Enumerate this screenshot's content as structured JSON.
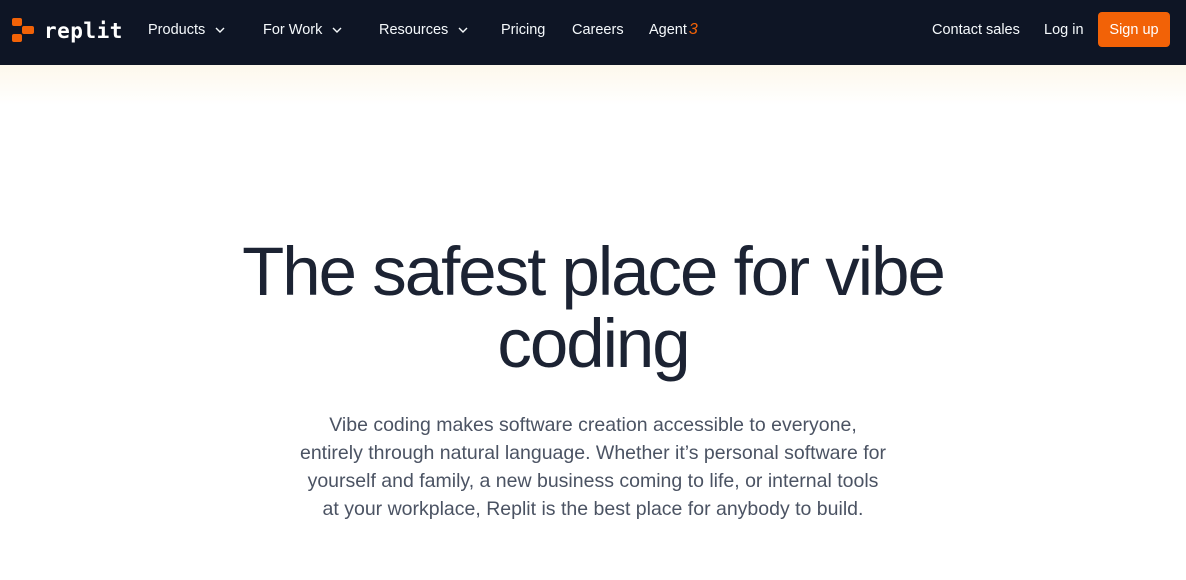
{
  "brand": {
    "name": "replit",
    "accent_color": "#f26207",
    "nav_background": "#0e1525"
  },
  "nav": {
    "products": "Products",
    "for_work": "For Work",
    "resources": "Resources",
    "pricing": "Pricing",
    "careers": "Careers",
    "agent": "Agent",
    "agent_version": "3",
    "contact_sales": "Contact sales",
    "log_in": "Log in",
    "sign_up": "Sign up"
  },
  "hero": {
    "title": "The safest place for vibe coding",
    "subtitle": "Vibe coding makes software creation accessible to everyone, entirely through natural language. Whether it’s personal software for yourself and family, a new business coming to life, or internal tools at your workplace, Replit is the best place for anybody to build."
  }
}
